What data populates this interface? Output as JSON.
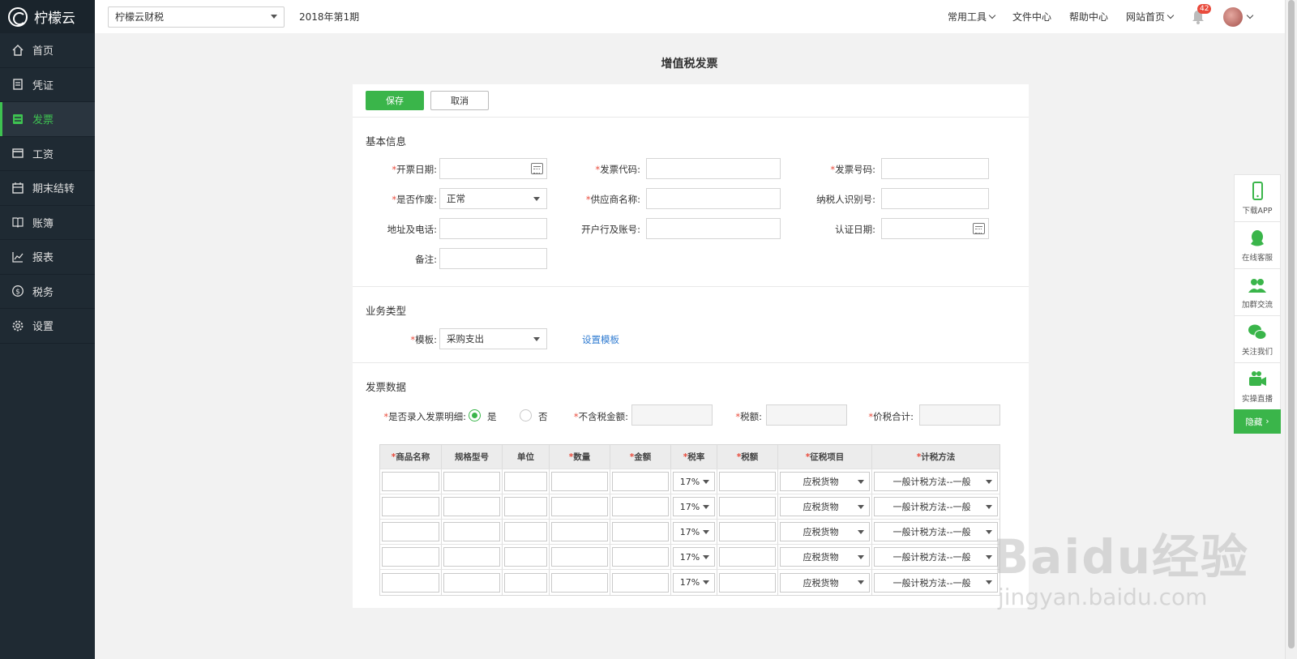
{
  "app": {
    "logo_text": "柠檬云"
  },
  "sidebar": {
    "items": [
      {
        "label": "首页",
        "icon": "home-icon",
        "active": false
      },
      {
        "label": "凭证",
        "icon": "voucher-icon",
        "active": false
      },
      {
        "label": "发票",
        "icon": "invoice-icon",
        "active": true
      },
      {
        "label": "工资",
        "icon": "salary-card-icon",
        "active": false
      },
      {
        "label": "期末结转",
        "icon": "calendar-icon",
        "active": false
      },
      {
        "label": "账簿",
        "icon": "book-icon",
        "active": false
      },
      {
        "label": "报表",
        "icon": "chart-icon",
        "active": false
      },
      {
        "label": "税务",
        "icon": "dollar-icon",
        "active": false
      },
      {
        "label": "设置",
        "icon": "gear-icon",
        "active": false
      }
    ]
  },
  "topbar": {
    "company": "柠檬云财税",
    "period": "2018年第1期",
    "links": [
      "常用工具",
      "文件中心",
      "帮助中心",
      "网站首页"
    ],
    "notification_count": "42"
  },
  "page": {
    "title": "增值税发票",
    "save_label": "保存",
    "cancel_label": "取消"
  },
  "basic_info": {
    "title": "基本信息",
    "invoice_date_label": "开票日期:",
    "invoice_code_label": "发票代码:",
    "invoice_number_label": "发票号码:",
    "void_label": "是否作废:",
    "void_value": "正常",
    "supplier_label": "供应商名称:",
    "taxpayer_id_label": "纳税人识别号:",
    "address_label": "地址及电话:",
    "bank_label": "开户行及账号:",
    "cert_date_label": "认证日期:",
    "remark_label": "备注:"
  },
  "business": {
    "title": "业务类型",
    "template_label": "模板:",
    "template_value": "采购支出",
    "set_template_link": "设置模板"
  },
  "invoice_data": {
    "title": "发票数据",
    "detail_label": "是否录入发票明细:",
    "yes_label": "是",
    "no_label": "否",
    "untaxed_label": "不含税金额:",
    "tax_label": "税额:",
    "total_label": "价税合计:",
    "columns": [
      "商品名称",
      "规格型号",
      "单位",
      "数量",
      "金额",
      "税率",
      "税额",
      "征税项目",
      "计税方法"
    ],
    "rows": [
      {
        "rate": "17%",
        "tax_item": "应税货物",
        "method": "一般计税方法--一般"
      },
      {
        "rate": "17%",
        "tax_item": "应税货物",
        "method": "一般计税方法--一般"
      },
      {
        "rate": "17%",
        "tax_item": "应税货物",
        "method": "一般计税方法--一般"
      },
      {
        "rate": "17%",
        "tax_item": "应税货物",
        "method": "一般计税方法--一般"
      },
      {
        "rate": "17%",
        "tax_item": "应税货物",
        "method": "一般计税方法--一般"
      }
    ]
  },
  "float_panel": {
    "items": [
      {
        "label": "下载APP",
        "icon": "phone-icon"
      },
      {
        "label": "在线客服",
        "icon": "qq-icon"
      },
      {
        "label": "加群交流",
        "icon": "group-icon"
      },
      {
        "label": "关注我们",
        "icon": "wechat-icon"
      },
      {
        "label": "实操直播",
        "icon": "video-icon"
      }
    ],
    "hide_label": "隐藏"
  },
  "watermark": {
    "line1": "Baidu经验",
    "line2": "jingyan.baidu.com"
  }
}
